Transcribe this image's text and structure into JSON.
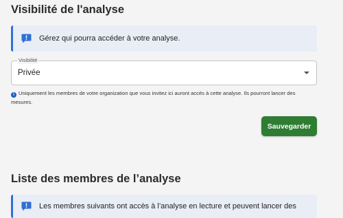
{
  "visibility_section": {
    "title": "Visibilité de l'analyse",
    "banner_text": "Gérez qui pourra accéder à votre analyse.",
    "select": {
      "label": "Visibilité",
      "value": "Privée"
    },
    "helper_text": "Uniquement les membres de votre organization que vous invitez ici auront accès à cette analyse. Ils pourront lancer des mesures.",
    "save_label": "Sauvegarder"
  },
  "members_section": {
    "title": "Liste des membres de l’analyse",
    "banner_text": "Les membres suivants ont accès à l’analyse en lecture et peuvent lancer des"
  },
  "colors": {
    "accent_blue": "#2f6fd4",
    "banner_bg": "#e8edf6",
    "save_green": "#2e7d32"
  },
  "icons": {
    "banner": "info-message-icon",
    "helper": "info-circle-icon",
    "select": "dropdown-arrow-icon"
  }
}
